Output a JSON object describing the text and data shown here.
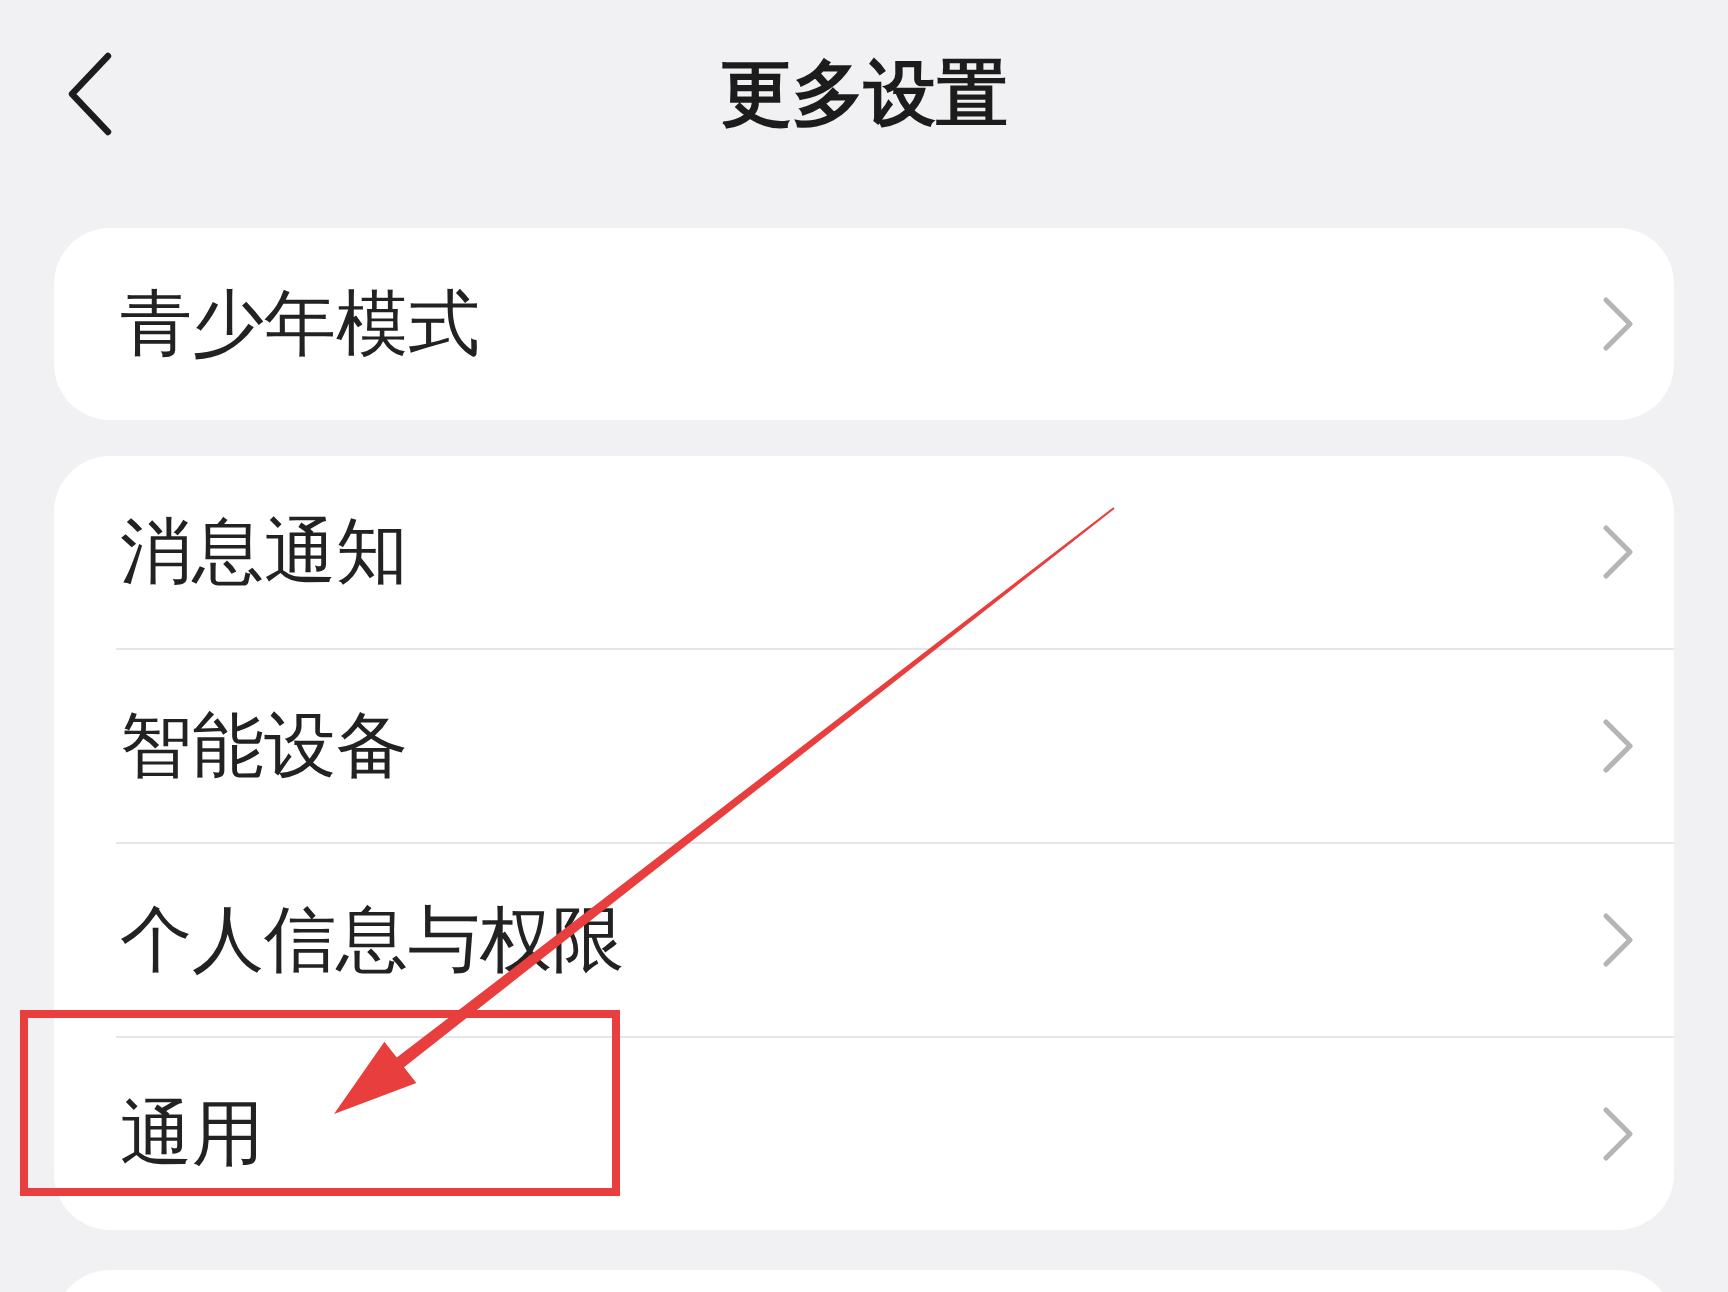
{
  "header": {
    "title": "更多设置"
  },
  "groups": [
    {
      "items": [
        {
          "label": "青少年模式",
          "highlighted": false
        }
      ]
    },
    {
      "items": [
        {
          "label": "消息通知",
          "highlighted": false
        },
        {
          "label": "智能设备",
          "highlighted": false
        },
        {
          "label": "个人信息与权限",
          "highlighted": false
        },
        {
          "label": "通用",
          "highlighted": true
        }
      ]
    }
  ]
}
